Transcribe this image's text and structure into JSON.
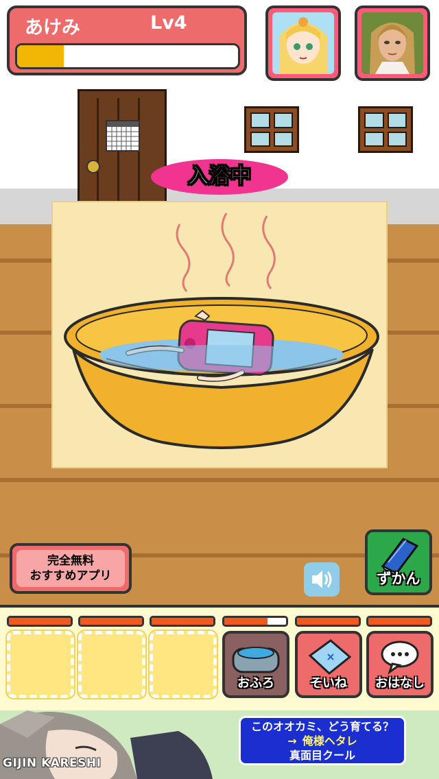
{
  "header": {
    "character_name": "あけみ",
    "level": "Lv4",
    "xp_progress": 0.21
  },
  "scene": {
    "activity_badge": "入浴中"
  },
  "buttons": {
    "promo_line1": "完全無料",
    "promo_line2": "おすすめアプリ",
    "encyclopedia": "ずかん"
  },
  "gauges": [
    0,
    0,
    0,
    0.3,
    0,
    0
  ],
  "actions": [
    {
      "label": "おふろ",
      "state": "active"
    },
    {
      "label": "そいね",
      "state": "enabled"
    },
    {
      "label": "おはなし",
      "state": "enabled"
    }
  ],
  "ad": {
    "brand": "GIJIN KARESHI",
    "line1": "このオオカミ、どう育てる？",
    "arrow": "→",
    "line2": "俺様ヘタレ",
    "line3": "真面目クール"
  },
  "colors": {
    "header_red": "#ee6b6b",
    "xp_yellow": "#f2b705",
    "badge_pink": "#f0348f",
    "gauge_orange": "#f05a1a",
    "zukan_green": "#2ca84a",
    "ad_blue": "#1b2fd0"
  }
}
